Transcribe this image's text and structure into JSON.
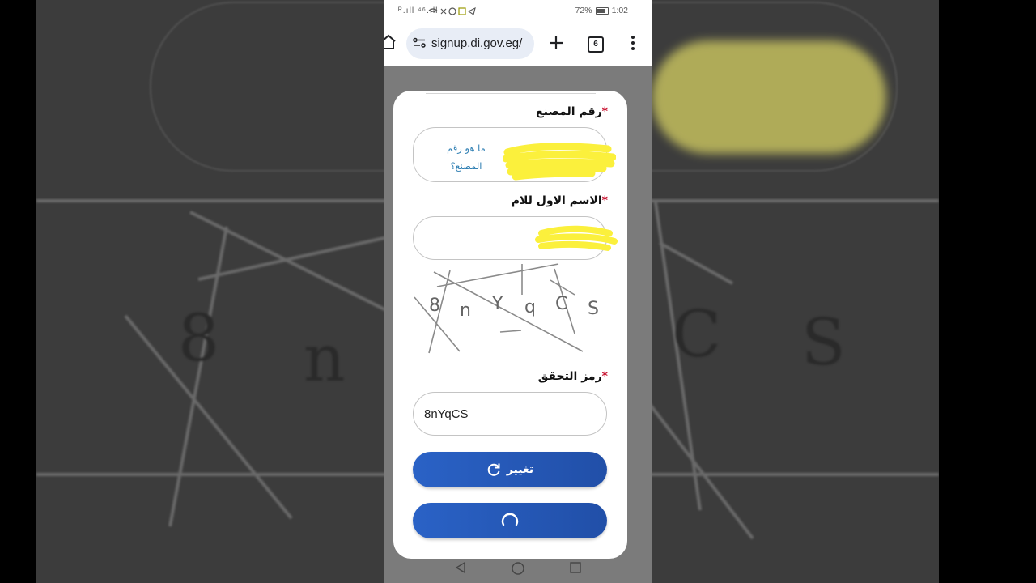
{
  "status_bar": {
    "signal": "ᴿ.ıll ⁴⁶.ıll",
    "battery_percent": "72%",
    "time": "1:02",
    "icons": [
      "wifi-icon",
      "missed-call-icon",
      "whatsapp-icon",
      "notification-icon",
      "telegram-icon",
      "battery-icon"
    ]
  },
  "browser": {
    "url": "signup.di.gov.eg/",
    "tab_count": "6",
    "icons": [
      "home-icon",
      "site-settings-icon",
      "plus-icon",
      "tabs-icon",
      "menu-icon"
    ]
  },
  "form": {
    "factory_number": {
      "label": "رقم المصنع",
      "required_mark": "*",
      "help_link": "ما هو رقم المصنع؟"
    },
    "mother_first_name": {
      "label": "الاسم الاول للام",
      "required_mark": "*"
    },
    "captcha": {
      "characters": [
        "8",
        "n",
        "Y",
        "q",
        "C",
        "S"
      ]
    },
    "verification_code": {
      "label": "رمز التحقق",
      "required_mark": "*",
      "value": "8nYqCS"
    },
    "change_button": {
      "label": "تغيير",
      "icon": "refresh-icon"
    },
    "submit_button": {
      "state": "loading",
      "icon": "spinner-icon"
    }
  },
  "nav_bar": {
    "icons": [
      "back-icon",
      "home-circle-icon",
      "recents-icon"
    ]
  },
  "colors": {
    "button": "#2557b8",
    "required": "#c8102e",
    "link": "#2f7fb3",
    "scribble": "#fbf03c"
  }
}
